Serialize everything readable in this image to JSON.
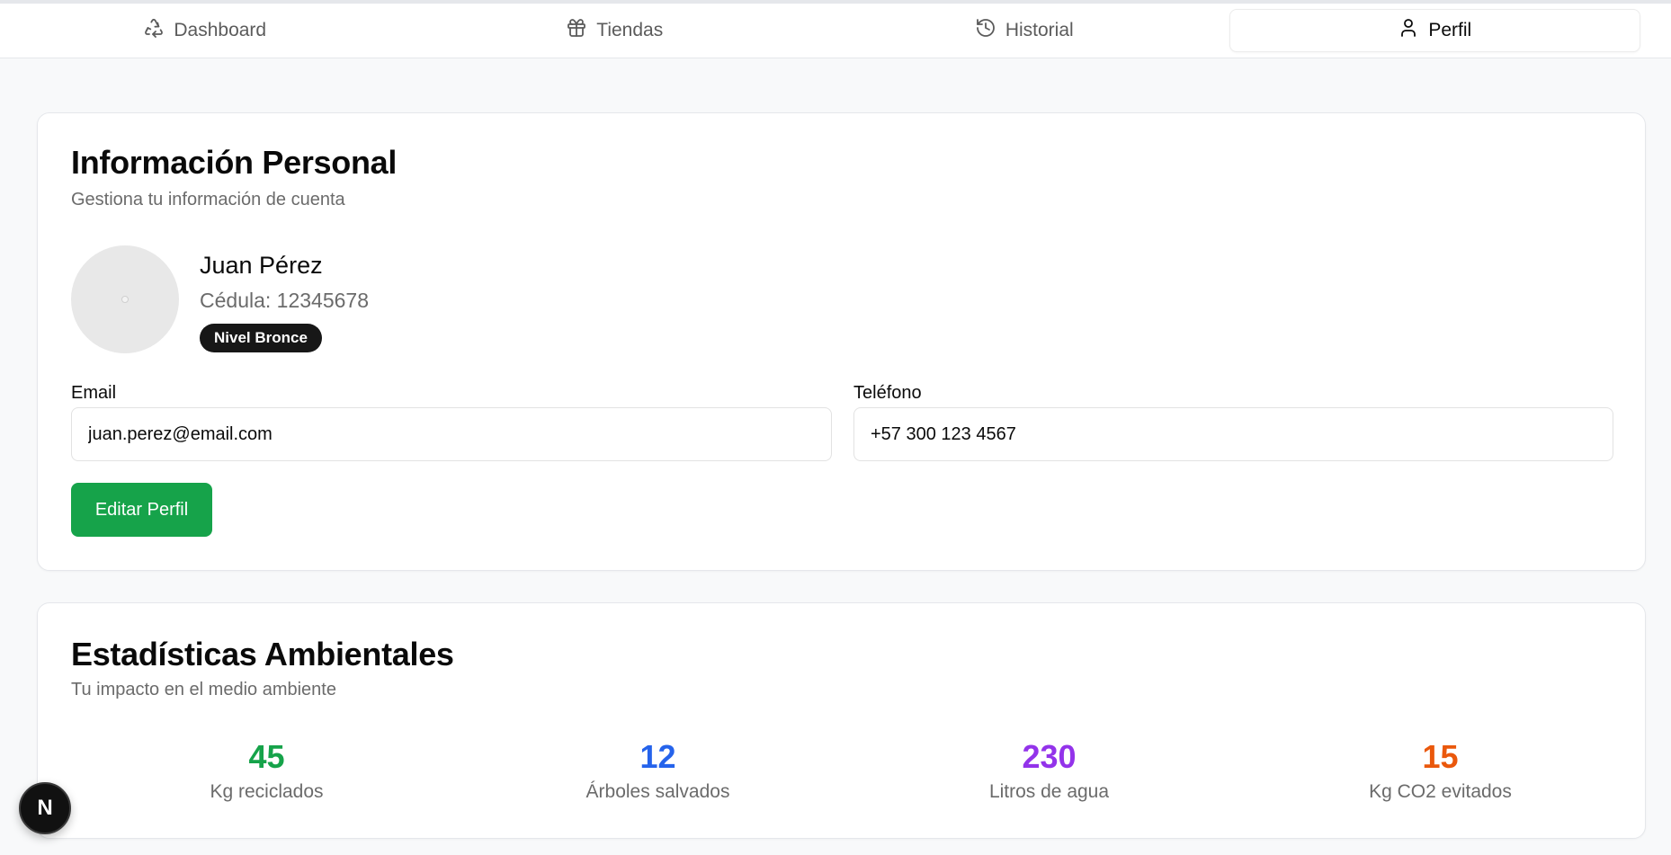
{
  "nav": {
    "tabs": [
      {
        "label": "Dashboard",
        "icon": "recycle-icon",
        "active": false
      },
      {
        "label": "Tiendas",
        "icon": "gift-icon",
        "active": false
      },
      {
        "label": "Historial",
        "icon": "history-icon",
        "active": false
      },
      {
        "label": "Perfil",
        "icon": "user-icon",
        "active": true
      }
    ]
  },
  "personal": {
    "title": "Información Personal",
    "subtitle": "Gestiona tu información de cuenta",
    "user": {
      "name": "Juan Pérez",
      "id_line": "Cédula: 12345678",
      "level_badge": "Nivel Bronce"
    },
    "email": {
      "label": "Email",
      "value": "juan.perez@email.com"
    },
    "phone": {
      "label": "Teléfono",
      "value": "+57 300 123 4567"
    },
    "edit_button": "Editar Perfil"
  },
  "stats": {
    "title": "Estadísticas Ambientales",
    "subtitle": "Tu impacto en el medio ambiente",
    "items": [
      {
        "value": "45",
        "label": "Kg reciclados",
        "color": "#16a34a"
      },
      {
        "value": "12",
        "label": "Árboles salvados",
        "color": "#2563eb"
      },
      {
        "value": "230",
        "label": "Litros de agua",
        "color": "#9333ea"
      },
      {
        "value": "15",
        "label": "Kg CO2 evitados",
        "color": "#ea580c"
      }
    ]
  },
  "fab": {
    "label": "N"
  },
  "colors": {
    "accent": "#16a34a",
    "badge_bg": "#171717",
    "page_bg": "#f8f9fa"
  }
}
